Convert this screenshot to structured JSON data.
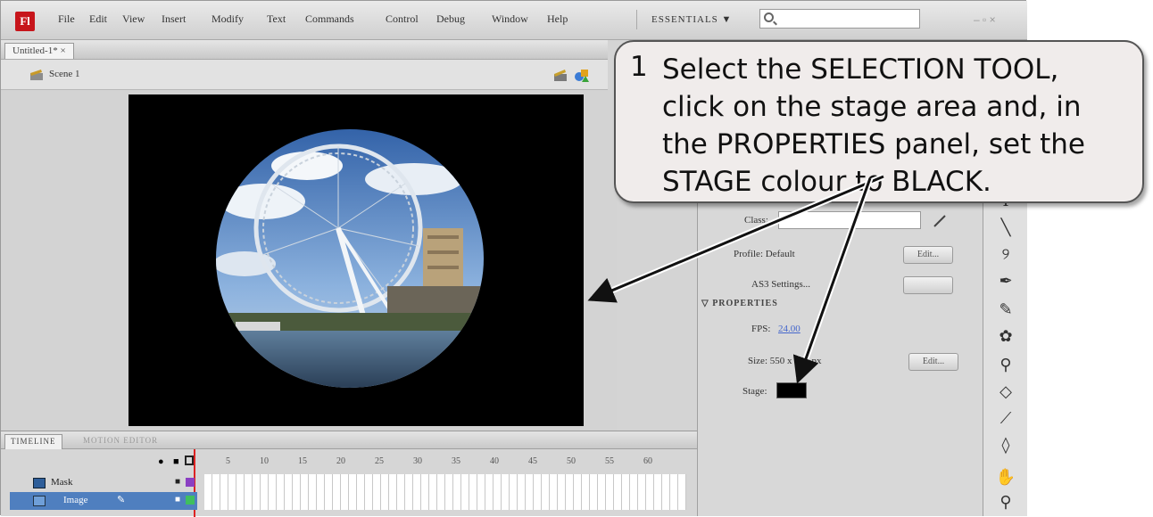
{
  "app": {
    "logo_letter": "Fl",
    "menu": [
      "File",
      "Edit",
      "View",
      "Insert",
      "Modify",
      "Text",
      "Commands",
      "Control",
      "Debug",
      "Window",
      "Help"
    ],
    "workspace": "ESSENTIALS ▼",
    "window_controls": "– ▫ ×"
  },
  "document": {
    "tab": "Untitled-1* ×",
    "scene": "Scene 1"
  },
  "properties_panel": {
    "class_label": "Class:",
    "profile_label": "Profile: Default",
    "edit_button": "Edit...",
    "as_settings_label": "AS3 Settings...",
    "section_title": "PROPERTIES",
    "fps_label": "FPS:",
    "fps_value": "24.00",
    "size_label": "Size: 550 x 400 px",
    "size_edit_button": "Edit...",
    "stage_label": "Stage:",
    "stage_color": "#000000"
  },
  "timeline": {
    "tabs": [
      "TIMELINE",
      "MOTION EDITOR"
    ],
    "frame_numbers": [
      "5",
      "10",
      "15",
      "20",
      "25",
      "30",
      "35",
      "40",
      "45",
      "50",
      "55",
      "60"
    ],
    "layers": [
      {
        "name": "Mask"
      },
      {
        "name": "Image"
      }
    ]
  },
  "callout": {
    "number": "1",
    "text": "Select the SELECTION TOOL, click on the stage area and, in the PROPERTIES panel, set the STAGE colour to BLACK."
  },
  "colors": {
    "callout_bg": "#f0eceb",
    "stage_bg": "#000000",
    "selected_layer": "#4f7fbf"
  }
}
